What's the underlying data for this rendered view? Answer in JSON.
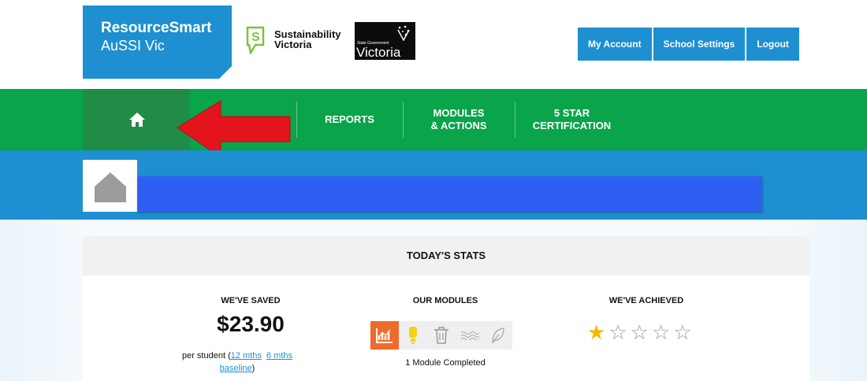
{
  "brand": {
    "title": "ResourceSmart",
    "subtitle": "AuSSI Vic"
  },
  "logos": {
    "sustainability": {
      "line1": "Sustainability",
      "line2": "Victoria"
    },
    "victoria": {
      "small": "State Government",
      "big": "Victoria"
    }
  },
  "top_nav": [
    "My Account",
    "School Settings",
    "Logout"
  ],
  "main_nav": {
    "home_icon": "home-icon",
    "items": [
      {
        "label": "REPORTS"
      },
      {
        "label": "MODULES\n& ACTIONS"
      },
      {
        "label": "5 STAR\nCERTIFICATION"
      }
    ]
  },
  "stats": {
    "heading": "TODAY'S STATS",
    "saved": {
      "title": "WE'VE SAVED",
      "amount": "$23.90",
      "per_student": "per student (",
      "link_12": "12 mths",
      "link_6": "6 mths",
      "link_baseline": "baseline",
      "close": ")"
    },
    "modules": {
      "title": "OUR MODULES",
      "icons": [
        "energy-chart-icon",
        "bulb-icon",
        "bin-icon",
        "water-icon",
        "leaf-icon"
      ],
      "completed": "1 Module Completed"
    },
    "achieved": {
      "title": "WE'VE ACHIEVED",
      "stars_total": 5,
      "stars_filled": 1
    }
  },
  "colors": {
    "blue": "#1e8fd0",
    "green": "#0aa44b",
    "orange": "#ef6a2b",
    "redaction": "#2f5ff2",
    "arrow": "#e3141b",
    "star": "#f5b800"
  }
}
